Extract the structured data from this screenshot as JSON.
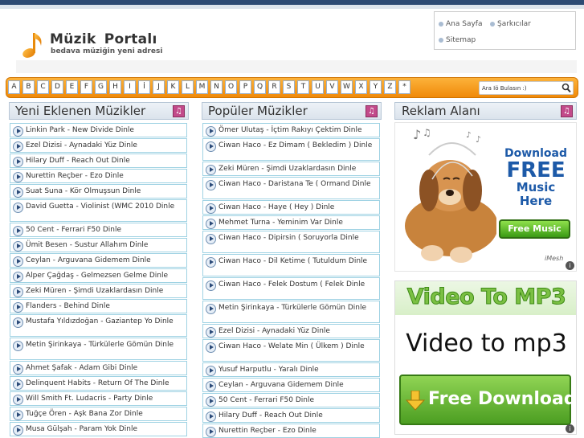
{
  "site": {
    "title": "Müzik Portalı",
    "subtitle": "bedava müziğin yeni adresi"
  },
  "topnav": [
    {
      "label": "Ana Sayfa"
    },
    {
      "label": "Şarkıcılar"
    },
    {
      "label": "Sitemap"
    }
  ],
  "alphabet": [
    "A",
    "B",
    "C",
    "D",
    "E",
    "F",
    "G",
    "H",
    "I",
    "İ",
    "J",
    "K",
    "L",
    "M",
    "N",
    "O",
    "P",
    "Q",
    "R",
    "S",
    "T",
    "U",
    "V",
    "W",
    "X",
    "Y",
    "Z",
    "*"
  ],
  "search": {
    "value": "Ara İö Bulasın :)"
  },
  "columns": {
    "new": {
      "title": "Yeni Eklenen Müzikler",
      "items": [
        "Linkin Park - New Divide Dinle",
        "Ezel Dizisi - Aynadaki Yüz Dinle",
        "Hilary Duff - Reach Out Dinle",
        "Nurettin Reçber - Ezo Dinle",
        "Suat Suna - Kör Olmuşsun Dinle",
        "David Guetta - Violinist (WMC 2010 Dinle",
        "50 Cent - Ferrari F50 Dinle",
        "Ümit Besen - Sustur Allahım Dinle",
        "Ceylan - Arguvana Gidemem Dinle",
        "Alper Çağdaş - Gelmezsen Gelme Dinle",
        "Zeki Müren - Şimdi Uzaklardasın Dinle",
        "Flanders - Behind Dinle",
        "Mustafa Yıldızdoğan - Gaziantep Yo Dinle",
        "Metin Şirinkaya - Türkülerle Gömün Dinle",
        "Ahmet Şafak - Adam Gibi Dinle",
        "Delinquent Habits - Return Of The Dinle",
        "Will Smith Ft. Ludacris - Party Dinle",
        "Tuğçe Ören - Aşk Bana Zor Dinle",
        "Musa Gülşah - Param Yok Dinle"
      ]
    },
    "popular": {
      "title": "Popüler Müzikler",
      "items": [
        "Ömer Ulutaş - İçtim Rakıyı Çektim Dinle",
        "Ciwan Haco - Ez Dimam ( Bekledim ) Dinle",
        "Zeki Müren - Şimdi Uzaklardasın Dinle",
        "Ciwan Haco - Daristana Te ( Ormand Dinle",
        "Ciwan Haco - Haye ( Hey ) Dinle",
        "Mehmet Turna - Yeminim Var Dinle",
        "Ciwan Haco - Dipirsin ( Soruyorla Dinle",
        "Ciwan Haco - Dil Ketime ( Tutuldum Dinle",
        "Ciwan Haco - Felek Dostum ( Felek Dinle",
        "Metin Şirinkaya - Türkülerle Gömün Dinle",
        "Ezel Dizisi - Aynadaki Yüz Dinle",
        "Ciwan Haco - Welate Min ( Ülkem ) Dinle",
        "Yusuf Harputlu - Yaralı Dinle",
        "Ceylan - Arguvana Gidemem Dinle",
        "50 Cent - Ferrari F50 Dinle",
        "Hilary Duff - Reach Out Dinle",
        "Nurettin Reçber - Ezo Dinle"
      ]
    }
  },
  "ads": {
    "title": "Reklam Alanı",
    "ad1": {
      "line1": "Download",
      "line2": "FREE",
      "line3": "Music",
      "line4": "Here",
      "button": "Free Music",
      "brand": "iMesh"
    },
    "ad2": {
      "headline": "Video To MP3",
      "body": "Video to mp3",
      "button": "Free Download"
    }
  },
  "colors": {
    "accent_orange": "#f7a021",
    "topbar": "#2d4a73",
    "item_border": "#9fd2e3",
    "ad_green": "#5cb32e"
  }
}
